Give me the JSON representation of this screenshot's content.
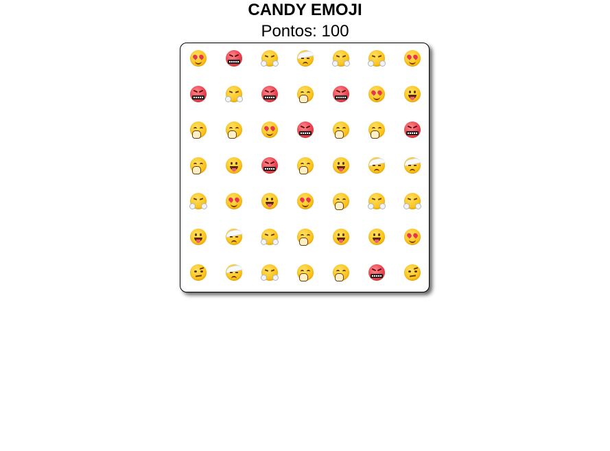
{
  "game": {
    "title": "CANDY EMOJI",
    "score_text": "Pontos: 100"
  },
  "board": {
    "rows": 7,
    "cols": 7,
    "cells": [
      [
        "heart-eyes-emoji",
        "angry-grawlix-emoji",
        "triumph-steam-emoji",
        "bandage-head-emoji",
        "triumph-steam-emoji",
        "triumph-steam-emoji",
        "heart-eyes-emoji"
      ],
      [
        "angry-grawlix-emoji",
        "triumph-steam-emoji",
        "angry-grawlix-emoji",
        "hand-over-mouth-emoji",
        "angry-grawlix-emoji",
        "heart-eyes-emoji",
        "tongue-out-emoji"
      ],
      [
        "hand-over-mouth-emoji",
        "hand-over-mouth-emoji",
        "heart-eyes-emoji",
        "angry-grawlix-emoji",
        "hand-over-mouth-emoji",
        "hand-over-mouth-emoji",
        "angry-grawlix-emoji"
      ],
      [
        "hand-over-mouth-emoji",
        "tongue-out-emoji",
        "angry-grawlix-emoji",
        "hand-over-mouth-emoji",
        "tongue-out-emoji",
        "bandage-head-emoji",
        "bandage-head-emoji"
      ],
      [
        "triumph-steam-emoji",
        "heart-eyes-emoji",
        "tongue-out-emoji",
        "heart-eyes-emoji",
        "hand-over-mouth-emoji",
        "triumph-steam-emoji",
        "triumph-steam-emoji"
      ],
      [
        "tongue-out-emoji",
        "bandage-head-emoji",
        "triumph-steam-emoji",
        "hand-over-mouth-emoji",
        "tongue-out-emoji",
        "tongue-out-emoji",
        "heart-eyes-emoji"
      ],
      [
        "skeptical-raised-eyebrow-emoji",
        "bandage-head-emoji",
        "triumph-steam-emoji",
        "hand-over-mouth-emoji",
        "hand-over-mouth-emoji",
        "angry-grawlix-emoji",
        "skeptical-raised-eyebrow-emoji"
      ]
    ]
  }
}
